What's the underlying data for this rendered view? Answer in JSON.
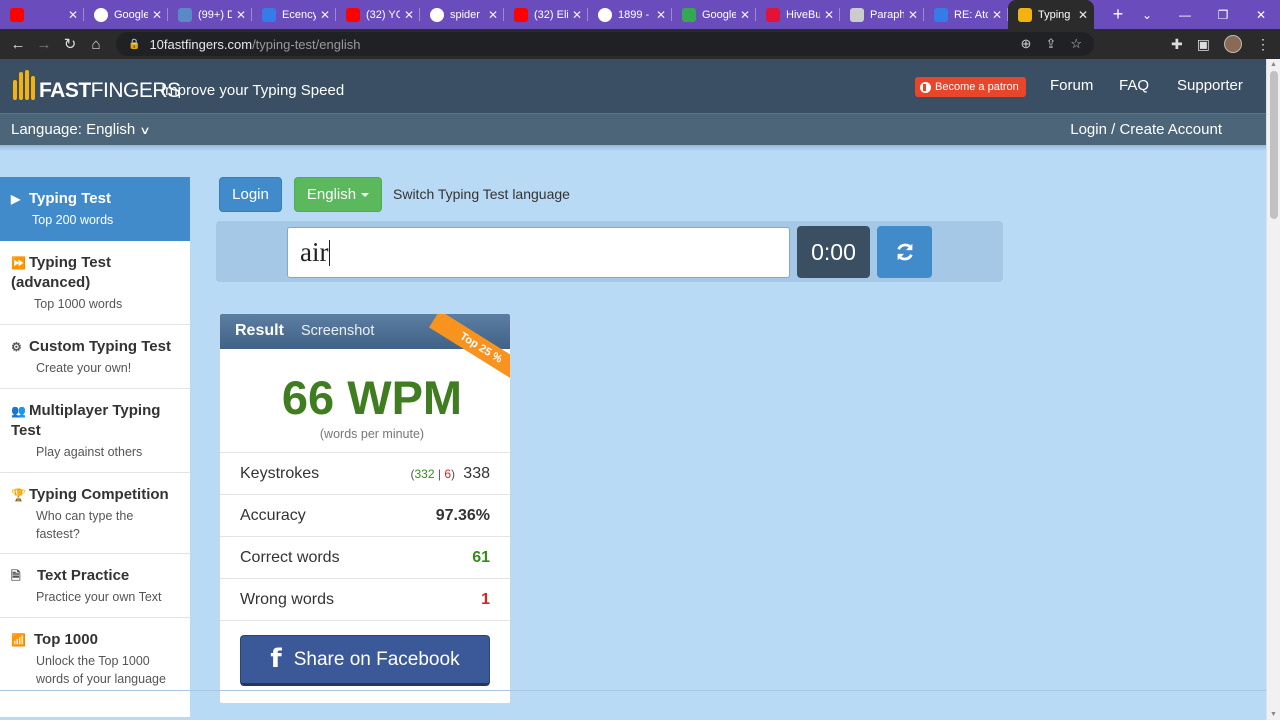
{
  "browser": {
    "tabs": [
      {
        "label": "",
        "color": "#ff0000",
        "favicon": "youtube-icon"
      },
      {
        "label": "Google",
        "color": "#ffffff",
        "favicon": "google-icon"
      },
      {
        "label": "(99+) D",
        "color": "#5b89c7",
        "favicon": "app-icon"
      },
      {
        "label": "Ecency",
        "color": "#357ce6",
        "favicon": "ecency-icon"
      },
      {
        "label": "(32) YC",
        "color": "#ff0000",
        "favicon": "youtube-icon"
      },
      {
        "label": "spider",
        "color": "#ffffff",
        "favicon": "google-icon"
      },
      {
        "label": "(32) Eli",
        "color": "#ff0000",
        "favicon": "youtube-icon"
      },
      {
        "label": "1899 -",
        "color": "#ffffff",
        "favicon": "google-icon"
      },
      {
        "label": "Google",
        "color": "#34a853",
        "favicon": "google-drive-icon"
      },
      {
        "label": "HiveBu",
        "color": "#e31337",
        "favicon": "hive-icon"
      },
      {
        "label": "Paraph",
        "color": "#cccccc",
        "favicon": "pen-icon"
      },
      {
        "label": "RE: Atc",
        "color": "#357ce6",
        "favicon": "ecency-icon"
      },
      {
        "label": "Typing",
        "color": "#f3b20f",
        "favicon": "10fastfingers-icon",
        "active": true
      }
    ],
    "url_host": "10fastfingers.com",
    "url_path": "/typing-test/english"
  },
  "header": {
    "logo_main": "FAST",
    "logo_thin": "FINGERS",
    "tagline": "Improve your Typing Speed",
    "patron_label": "Become a patron",
    "nav": [
      "Forum",
      "FAQ",
      "Supporter"
    ],
    "language_label": "Language: English",
    "login_create": "Login / Create Account"
  },
  "sidebar": {
    "items": [
      {
        "title": "Typing Test",
        "sub": "Top 200 words",
        "icon": "play-icon"
      },
      {
        "title": "Typing Test (advanced)",
        "sub": "Top 1000 words",
        "icon": "fast-forward-icon"
      },
      {
        "title": "Custom Typing Test",
        "sub": "Create your own!",
        "icon": "gears-icon"
      },
      {
        "title": "Multiplayer Typing Test",
        "sub": "Play against others",
        "icon": "users-icon"
      },
      {
        "title": "Typing Competition",
        "sub": "Who can type the fastest?",
        "icon": "trophy-icon"
      },
      {
        "title": "Text Practice",
        "sub": "Practice your own Text",
        "icon": "document-icon"
      },
      {
        "title": "Top 1000",
        "sub": "Unlock the Top 1000 words of your language",
        "icon": "signal-icon"
      }
    ]
  },
  "main": {
    "login_button": "Login",
    "language_button": "English",
    "switch_label": "Switch Typing Test language",
    "input_value": "air",
    "timer": "0:00"
  },
  "result": {
    "title": "Result",
    "screenshot_label": "Screenshot",
    "ribbon": "Top 25 %",
    "wpm": "66 WPM",
    "wpm_sub": "(words per minute)",
    "keystrokes_label": "Keystrokes",
    "keystrokes_correct": "332",
    "keystrokes_wrong": "6",
    "keystrokes_total": "338",
    "accuracy_label": "Accuracy",
    "accuracy_value": "97.36%",
    "correct_label": "Correct words",
    "correct_value": "61",
    "wrong_label": "Wrong words",
    "wrong_value": "1",
    "facebook_button": "Share on Facebook"
  },
  "colors": {
    "accent_blue": "#428bca",
    "green_button": "#5cb85c",
    "header_bg": "#3a4f63",
    "page_bg": "#b9daf5",
    "wpm_green": "#3f7d20",
    "facebook_blue": "#3b5998"
  }
}
